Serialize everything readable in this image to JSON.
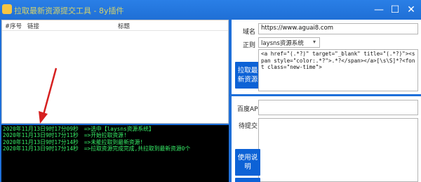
{
  "window": {
    "title": "拉取最新资源提交工具 - 8y插件",
    "minimize_glyph": "—",
    "maximize_glyph": "☐",
    "close_glyph": "✕"
  },
  "list": {
    "headers": [
      "#序号",
      "链接",
      "标题"
    ]
  },
  "log": {
    "lines": [
      {
        "time": "2020年11月13日9时17分09秒",
        "msg": "=>选中【laysns资源系统】"
      },
      {
        "time": "2020年11月13日9时17分11秒",
        "msg": "=>开始拉取资源!"
      },
      {
        "time": "2020年11月13日9时17分14秒",
        "msg": "=>未能拉取到最新资源!"
      },
      {
        "time": "2020年11月13日9时17分14秒",
        "msg": "=>拉取资源完成完成,共拉取到最新资源0个"
      }
    ]
  },
  "form": {
    "domain_label": "域名",
    "domain_value": "https://www.aguai8.com",
    "regex_label": "正则",
    "regex_value": "laysns资源系统",
    "pull_button": "拉取最新资源",
    "regex_pattern": "<a href=\"(.*?)\" target=\"_blank\" title=\"(.*?)\"><span style=\"color:.*?\">.*?</span></a>[\\s\\S]*?<font class=\"new-time\">",
    "baidu_api_label": "百度API",
    "pending_label": "待提交",
    "help_button": "使用说明"
  },
  "colors": {
    "accent": "#1e6fd9",
    "button": "#0d62d6",
    "log_text": "#38f26a",
    "annotation_arrow": "#d62020"
  }
}
